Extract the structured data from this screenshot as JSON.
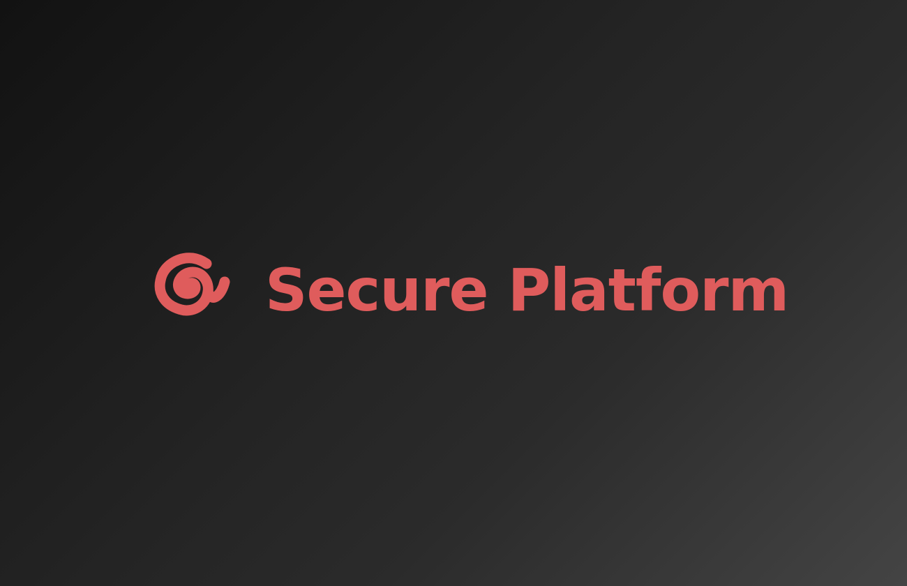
{
  "splash": {
    "brand_name": "Secure Platform",
    "logo_icon": "spiral-logo-icon"
  },
  "colors": {
    "background_dark": "#121212",
    "background_light": "#444444",
    "brand": "#df5c5c"
  }
}
